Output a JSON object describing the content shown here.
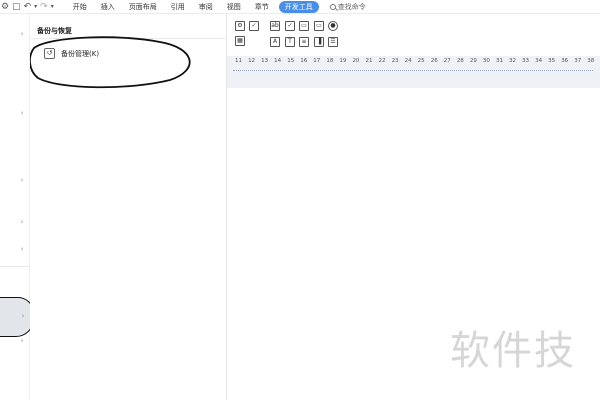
{
  "quick_access": {
    "icons": [
      "settings-icon",
      "doc-icon",
      "undo-icon",
      "undo-dropdown-icon",
      "redo-icon",
      "more-dropdown-icon"
    ]
  },
  "ribbon": {
    "tabs": [
      {
        "label": "开始",
        "active": false
      },
      {
        "label": "插入",
        "active": false
      },
      {
        "label": "页面布局",
        "active": false
      },
      {
        "label": "引用",
        "active": false
      },
      {
        "label": "审阅",
        "active": false
      },
      {
        "label": "视图",
        "active": false
      },
      {
        "label": "章节",
        "active": false
      },
      {
        "label": "开发工具",
        "active": true
      }
    ],
    "search_label": "查找命令",
    "active_color": "#4a8fe7"
  },
  "panel": {
    "title": "备份与恢复",
    "items": [
      {
        "label": "备份管理(K)",
        "icon": "undo-icon"
      }
    ]
  },
  "ruler": {
    "numbers": [
      "11",
      "12",
      "13",
      "14",
      "15",
      "16",
      "17",
      "18",
      "19",
      "20",
      "21",
      "22",
      "23",
      "24",
      "25",
      "26",
      "27",
      "28",
      "29",
      "30",
      "31",
      "32",
      "33",
      "34",
      "35",
      "36",
      "37",
      "38"
    ]
  },
  "watermark": {
    "text": "软件技"
  }
}
